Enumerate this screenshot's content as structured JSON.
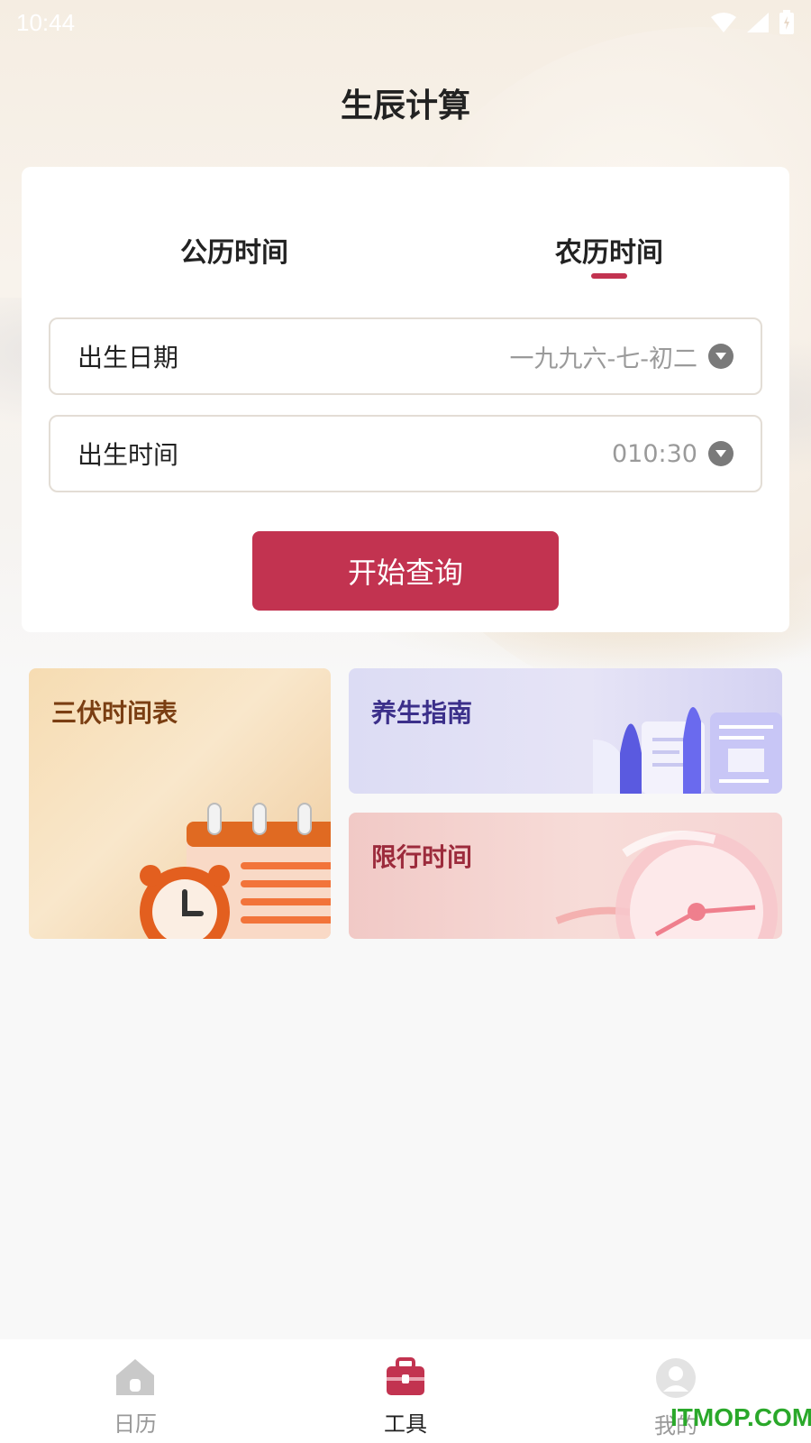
{
  "status_bar": {
    "time": "10:44"
  },
  "page_title": "生辰计算",
  "tabs": [
    {
      "label": "公历时间",
      "active": false
    },
    {
      "label": "农历时间",
      "active": true
    }
  ],
  "form": {
    "birth_date": {
      "label": "出生日期",
      "value": "一九九六-七-初二"
    },
    "birth_time": {
      "label": "出生时间",
      "value": "010:30"
    },
    "submit_label": "开始查询"
  },
  "tiles": {
    "sanfu": {
      "title": "三伏时间表"
    },
    "health": {
      "title": "养生指南"
    },
    "traffic": {
      "title": "限行时间"
    }
  },
  "bottom_nav": [
    {
      "label": "日历",
      "icon": "home-icon",
      "active": false
    },
    {
      "label": "工具",
      "icon": "toolbox-icon",
      "active": true
    },
    {
      "label": "我的",
      "icon": "profile-icon",
      "active": false
    }
  ],
  "watermark": "ITMOP.COM",
  "colors": {
    "accent": "#c23350",
    "background": "#f8f8f8"
  }
}
